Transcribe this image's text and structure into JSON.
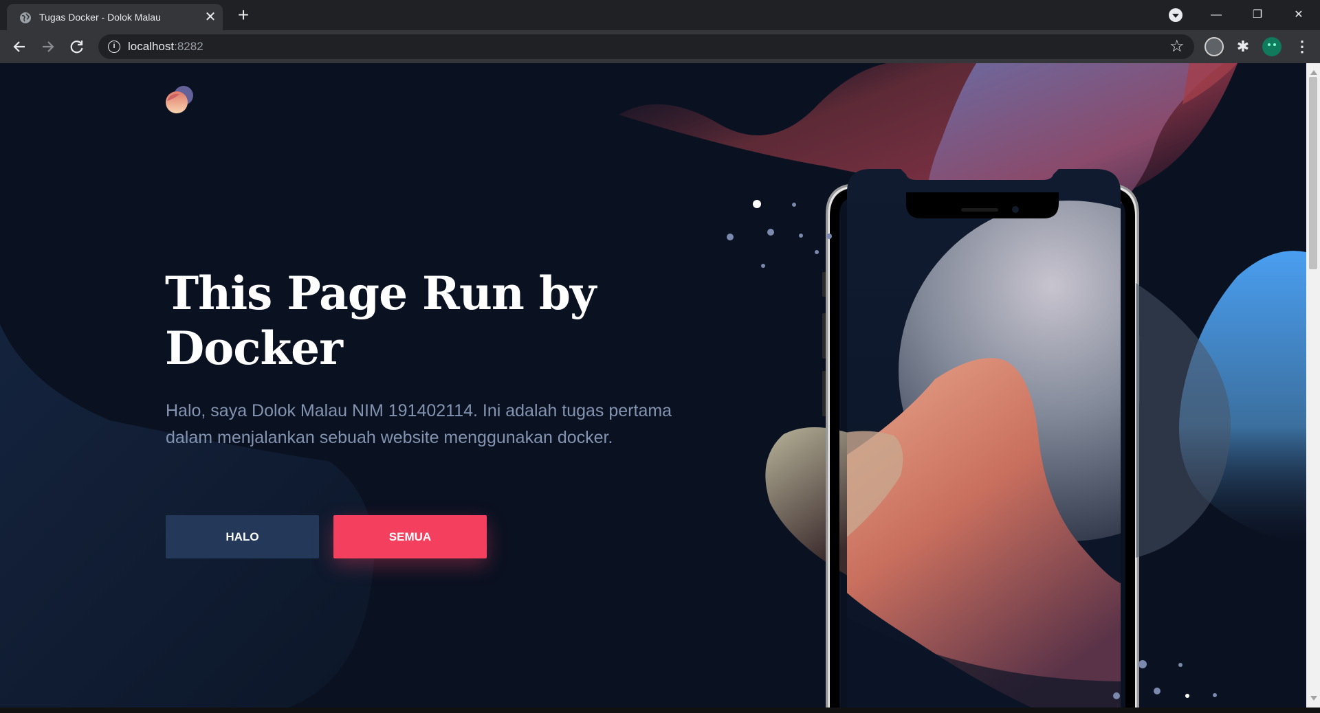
{
  "browser": {
    "tab_title": "Tugas Docker - Dolok Malau",
    "tab_close": "✕",
    "new_tab": "+",
    "url_host": "localhost",
    "url_port": ":8282",
    "window_controls": {
      "minimize": "—",
      "restore": "❐",
      "close": "✕"
    },
    "icons": [
      "globe-icon",
      "back-icon",
      "forward-icon",
      "reload-icon",
      "info-icon",
      "star-icon",
      "extensions-icon",
      "profile-avatar",
      "menu-icon"
    ]
  },
  "hero": {
    "title": "This Page Run by Docker",
    "description": "Halo, saya Dolok Malau NIM 191402114. Ini adalah tugas pertama dalam menjalankan sebuah website menggunakan docker.",
    "buttons": {
      "primary": "HALO",
      "secondary": "SEMUA"
    }
  },
  "colors": {
    "page_bg": "#0a1121",
    "button_primary": "#24395a",
    "button_accent": "#f43f5e",
    "text_muted": "#8393b0"
  }
}
